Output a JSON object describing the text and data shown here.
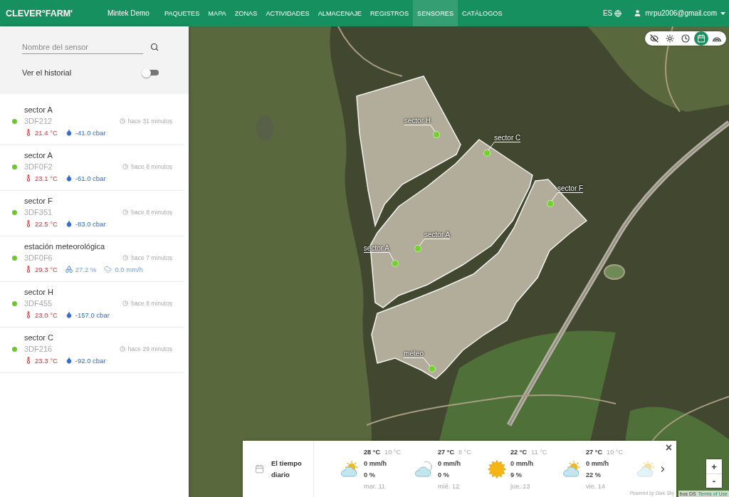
{
  "header": {
    "logo": "CLEVER°FARM'",
    "account": "Mintek Demo",
    "nav": [
      {
        "label": "PAQUETES",
        "selected": false
      },
      {
        "label": "MAPA",
        "selected": false
      },
      {
        "label": "ZONAS",
        "selected": false
      },
      {
        "label": "ACTIVIDADES",
        "selected": false
      },
      {
        "label": "ALMACENAJE",
        "selected": false
      },
      {
        "label": "REGISTROS",
        "selected": false
      },
      {
        "label": "SENSORES",
        "selected": true
      },
      {
        "label": "CATÁLOGOS",
        "selected": false
      }
    ],
    "language": "ES",
    "user": "mrpu2006@gmail.com"
  },
  "sidebar": {
    "search": {
      "placeholder": "Nombre del sensor"
    },
    "history_toggle": {
      "label": "Ver el historial",
      "on": false
    },
    "sensors": [
      {
        "name": "sector A",
        "code": "3DF212",
        "online": true,
        "updated": "hace 31 minutos",
        "readings": [
          {
            "kind": "temperature",
            "value": "21.4 °C"
          },
          {
            "kind": "soil_moisture",
            "value": "-41.0 cbar"
          }
        ]
      },
      {
        "name": "sector A",
        "code": "3DF0F2",
        "online": true,
        "updated": "hace 8 minutos",
        "readings": [
          {
            "kind": "temperature",
            "value": "23.1 °C"
          },
          {
            "kind": "soil_moisture",
            "value": "-61.0 cbar"
          }
        ]
      },
      {
        "name": "sector F",
        "code": "3DF351",
        "online": true,
        "updated": "hace 8 minutos",
        "readings": [
          {
            "kind": "temperature",
            "value": "22.5 °C"
          },
          {
            "kind": "soil_moisture",
            "value": "-83.0 cbar"
          }
        ]
      },
      {
        "name": "estación meteorológica",
        "code": "3DF0F6",
        "online": true,
        "updated": "hace 7 minutos",
        "readings": [
          {
            "kind": "temperature",
            "value": "29.3 °C"
          },
          {
            "kind": "humidity",
            "value": "27.2 %"
          },
          {
            "kind": "rain",
            "value": "0.0 mm/h"
          }
        ]
      },
      {
        "name": "sector H",
        "code": "3DF455",
        "online": true,
        "updated": "hace 8 minutos",
        "readings": [
          {
            "kind": "temperature",
            "value": "23.0 °C"
          },
          {
            "kind": "soil_moisture",
            "value": "-157.0 cbar"
          }
        ]
      },
      {
        "name": "sector C",
        "code": "3DF216",
        "online": true,
        "updated": "hace 29 minutos",
        "readings": [
          {
            "kind": "temperature",
            "value": "23.3 °C"
          },
          {
            "kind": "soil_moisture",
            "value": "-92.0 cbar"
          }
        ]
      }
    ]
  },
  "map": {
    "layers": [
      {
        "kind": "hide",
        "selected": false
      },
      {
        "kind": "sun",
        "selected": false
      },
      {
        "kind": "clock",
        "selected": false
      },
      {
        "kind": "calendar",
        "selected": true
      },
      {
        "kind": "signal",
        "selected": false
      }
    ],
    "markers": [
      {
        "label": "sector H"
      },
      {
        "label": "sector C"
      },
      {
        "label": "sector F"
      },
      {
        "label": "sector A"
      },
      {
        "label": "sector A"
      },
      {
        "label": "meteo"
      }
    ],
    "zoom": {
      "in": "+",
      "out": "-"
    },
    "attribution": {
      "text": "bus DS",
      "link": "Terms of Use"
    }
  },
  "weather": {
    "title": "El tiempo diario",
    "days": [
      {
        "kind": "partly_cloudy_day",
        "high": "28 °C",
        "low": "10 °C",
        "rain": "0 mm/h",
        "chance": "0 %",
        "date": "mar. 11"
      },
      {
        "kind": "partly_cloudy_night",
        "high": "27 °C",
        "low": "8 °C",
        "rain": "0 mm/h",
        "chance": "0 %",
        "date": "mié. 12"
      },
      {
        "kind": "clear_day",
        "high": "22 °C",
        "low": "11 °C",
        "rain": "0 mm/h",
        "chance": "9 %",
        "date": "jue. 13"
      },
      {
        "kind": "partly_cloudy_day",
        "high": "27 °C",
        "low": "10 °C",
        "rain": "0 mm/h",
        "chance": "22 %",
        "date": "vie. 14"
      },
      {
        "kind": "partly_cloudy_day"
      }
    ],
    "close": "×",
    "credit": "Powered by Dark Sky"
  }
}
